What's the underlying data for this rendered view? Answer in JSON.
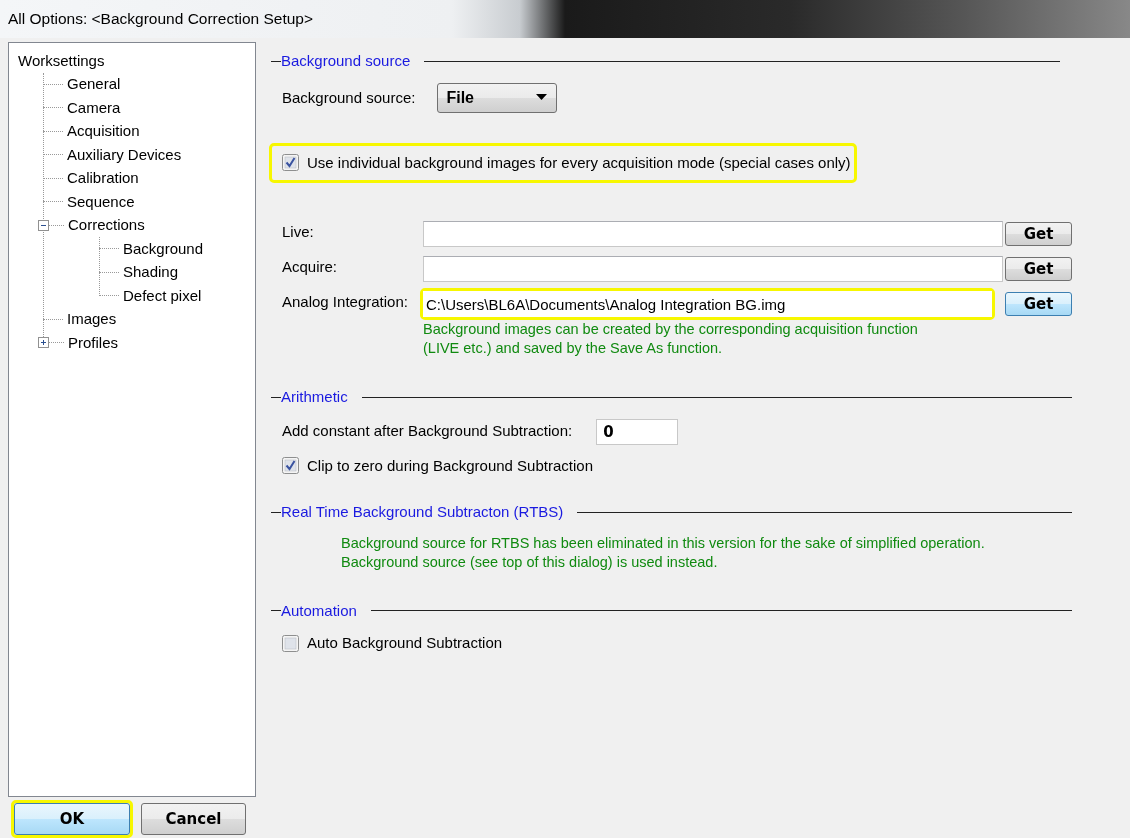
{
  "window": {
    "title": "All Options: <Background Correction Setup>"
  },
  "tree": {
    "items": [
      {
        "label": "Worksettings",
        "children": [
          {
            "label": "General"
          },
          {
            "label": "Camera"
          },
          {
            "label": "Acquisition"
          },
          {
            "label": "Auxiliary Devices"
          },
          {
            "label": "Calibration"
          },
          {
            "label": "Sequence"
          },
          {
            "label": "Corrections",
            "expanded": true,
            "children": [
              {
                "label": "Background"
              },
              {
                "label": "Shading"
              },
              {
                "label": "Defect pixel"
              }
            ]
          },
          {
            "label": "Images"
          },
          {
            "label": "Profiles",
            "expanded": false
          }
        ]
      }
    ]
  },
  "sections": [
    {
      "title": "Background source",
      "rows": [
        {
          "kind": "dropdown",
          "label": "Background source:",
          "value": "File"
        },
        {
          "kind": "checkbox",
          "label": "Use individual background images for every acquisition mode (special cases only)",
          "checked": true,
          "highlighted": true
        },
        {
          "kind": "file",
          "label": "Live:",
          "button": "Get",
          "focused": false,
          "highlighted": false
        },
        {
          "kind": "file",
          "label": "Acquire:",
          "button": "Get",
          "focused": false,
          "highlighted": false
        },
        {
          "kind": "file",
          "label": "Analog Integration:",
          "value": "C:\\Users\\BL6A\\Documents\\Analog Integration BG.img",
          "button": "Get",
          "focused": true,
          "highlighted": true
        },
        {
          "kind": "note",
          "lines": [
            "Background images can be created by the corresponding acquisition function",
            "(LIVE etc.) and saved by the Save As function."
          ]
        }
      ]
    },
    {
      "title": "Arithmetic",
      "rows": [
        {
          "kind": "number",
          "label": "Add constant after Background Subtraction:",
          "value": "0"
        },
        {
          "kind": "checkbox",
          "label": "Clip to zero during Background Subtraction",
          "checked": true,
          "highlighted": false
        }
      ]
    },
    {
      "title": "Real Time Background Subtracton (RTBS)",
      "rows": [
        {
          "kind": "note",
          "lines": [
            "Background source for RTBS has been eliminated in this version for the sake of simplified operation.",
            "Background source (see top of this dialog) is used instead."
          ]
        }
      ]
    },
    {
      "title": "Automation",
      "rows": [
        {
          "kind": "checkbox",
          "label": "Auto Background Subtraction",
          "checked": false,
          "highlighted": false
        }
      ]
    }
  ],
  "buttons": [
    {
      "label": "OK",
      "default": true,
      "highlighted": true
    },
    {
      "label": "Cancel",
      "default": false,
      "highlighted": false
    }
  ]
}
